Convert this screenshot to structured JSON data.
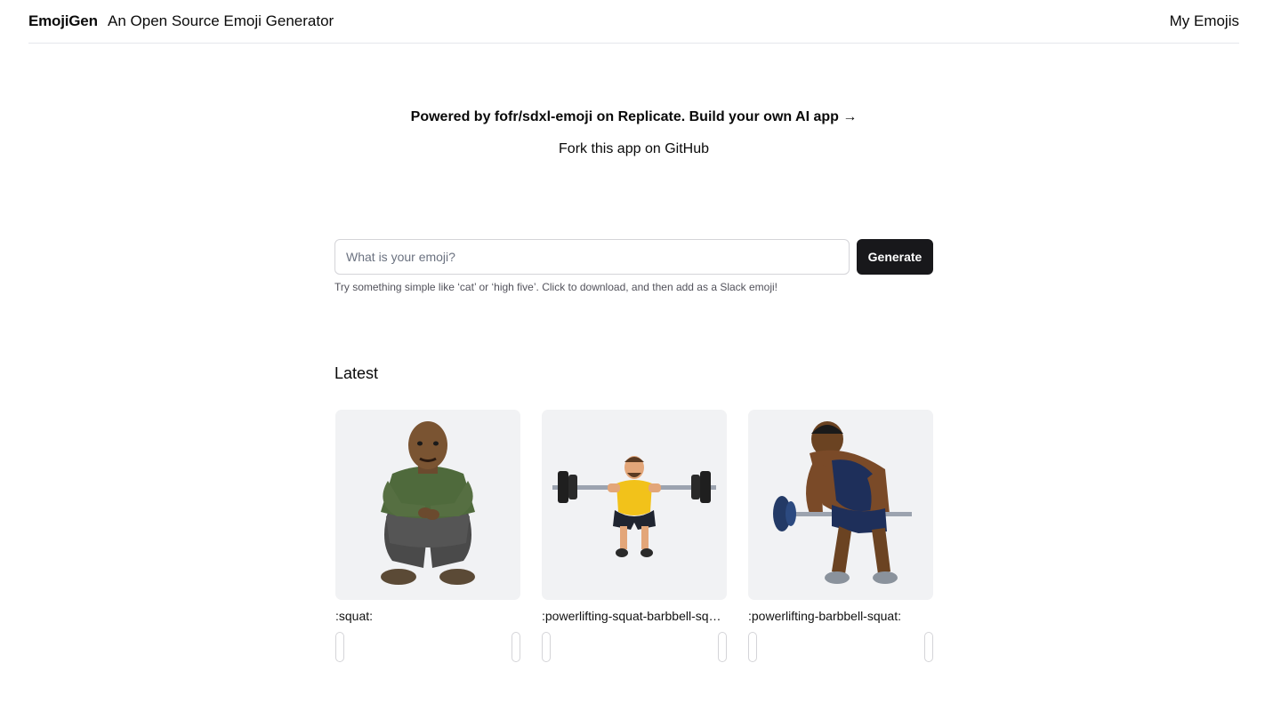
{
  "header": {
    "brand": "EmojiGen",
    "tagline": "An Open Source Emoji Generator",
    "my_emojis": "My Emojis"
  },
  "hero": {
    "powered": "Powered by fofr/sdxl-emoji on Replicate. Build your own AI app →",
    "fork": "Fork this app on GitHub"
  },
  "form": {
    "placeholder": "What is your emoji?",
    "value": "",
    "generate_label": "Generate",
    "hint": "Try something simple like ‘cat’ or ‘high five’. Click to download, and then add as a Slack emoji!"
  },
  "latest": {
    "heading": "Latest",
    "items": [
      {
        "name": ":squat:",
        "icon": "squatting-man-emoji"
      },
      {
        "name": ":powerlifting-squat-barbbell-squat:",
        "icon": "barbell-squat-emoji"
      },
      {
        "name": ":powerlifting-barbbell-squat:",
        "icon": "barbell-row-emoji"
      }
    ]
  }
}
